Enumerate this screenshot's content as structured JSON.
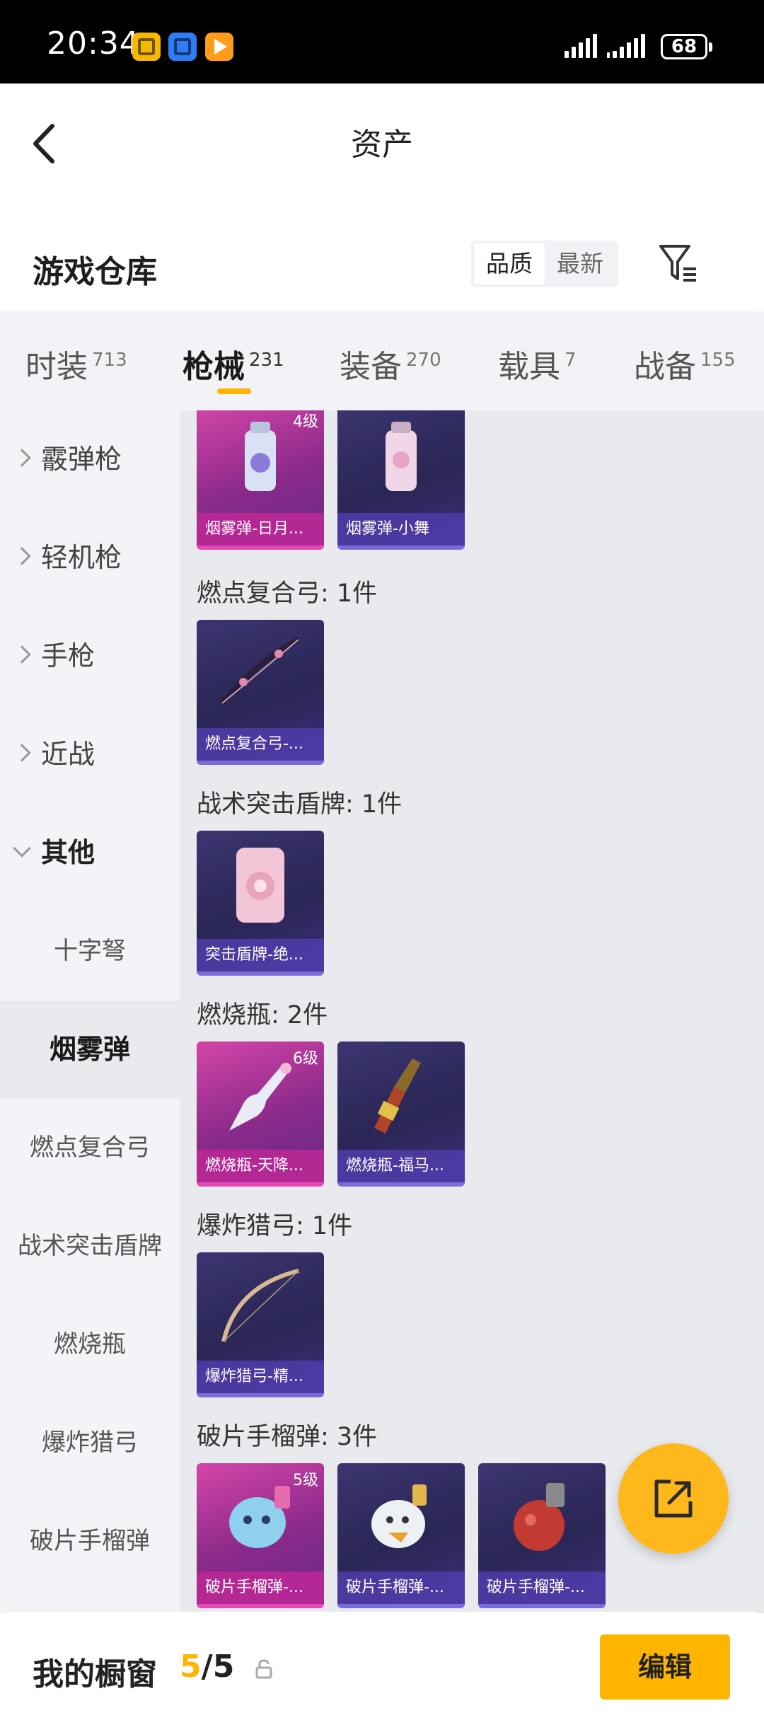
{
  "status_bar": {
    "time": "20:34",
    "battery": "68"
  },
  "header": {
    "title": "资产"
  },
  "section": {
    "title": "游戏仓库",
    "sort_quality": "品质",
    "sort_latest": "最新"
  },
  "tabs": [
    {
      "label": "时装",
      "count": "713"
    },
    {
      "label": "枪械",
      "count": "231"
    },
    {
      "label": "装备",
      "count": "270"
    },
    {
      "label": "载具",
      "count": "7"
    },
    {
      "label": "战备",
      "count": "155"
    }
  ],
  "sidebar": {
    "categories": [
      "霰弹枪",
      "轻机枪",
      "手枪",
      "近战",
      "其他"
    ],
    "subitems": [
      "十字弩",
      "烟雾弹",
      "燃点复合弓",
      "战术突击盾牌",
      "燃烧瓶",
      "爆炸猎弓",
      "破片手榴弹"
    ]
  },
  "groups": [
    {
      "title": "燃点复合弓: 1件"
    },
    {
      "title": "战术突击盾牌: 1件"
    },
    {
      "title": "燃烧瓶: 2件"
    },
    {
      "title": "爆炸猎弓: 1件"
    },
    {
      "title": "破片手榴弹: 3件"
    }
  ],
  "cards": {
    "smoke1": {
      "name": "烟雾弹-日月...",
      "level": "4级",
      "icon": "smoke-grenade-icon"
    },
    "smoke2": {
      "name": "烟雾弹-小舞",
      "icon": "smoke-grenade-icon"
    },
    "bow1": {
      "name": "燃点复合弓-...",
      "icon": "compound-bow-icon"
    },
    "shield1": {
      "name": "突击盾牌-绝...",
      "icon": "shield-icon"
    },
    "molotov1": {
      "name": "燃烧瓶-天降...",
      "level": "6级",
      "icon": "molotov-icon"
    },
    "molotov2": {
      "name": "燃烧瓶-福马...",
      "icon": "molotov-icon"
    },
    "hunting1": {
      "name": "爆炸猎弓-精...",
      "icon": "hunting-bow-icon"
    },
    "frag1": {
      "name": "破片手榴弹-...",
      "level": "5级",
      "icon": "frag-grenade-icon"
    },
    "frag2": {
      "name": "破片手榴弹-...",
      "icon": "frag-grenade-icon"
    },
    "frag3": {
      "name": "破片手榴弹-...",
      "icon": "frag-grenade-icon"
    }
  },
  "bottom": {
    "window_label": "我的橱窗",
    "count_current": "5",
    "count_sep": "/",
    "count_total": "5",
    "edit_label": "编辑"
  },
  "colors": {
    "accent": "#ffb400",
    "rare_card": "#d445a8",
    "normal_card": "#3c3572"
  }
}
